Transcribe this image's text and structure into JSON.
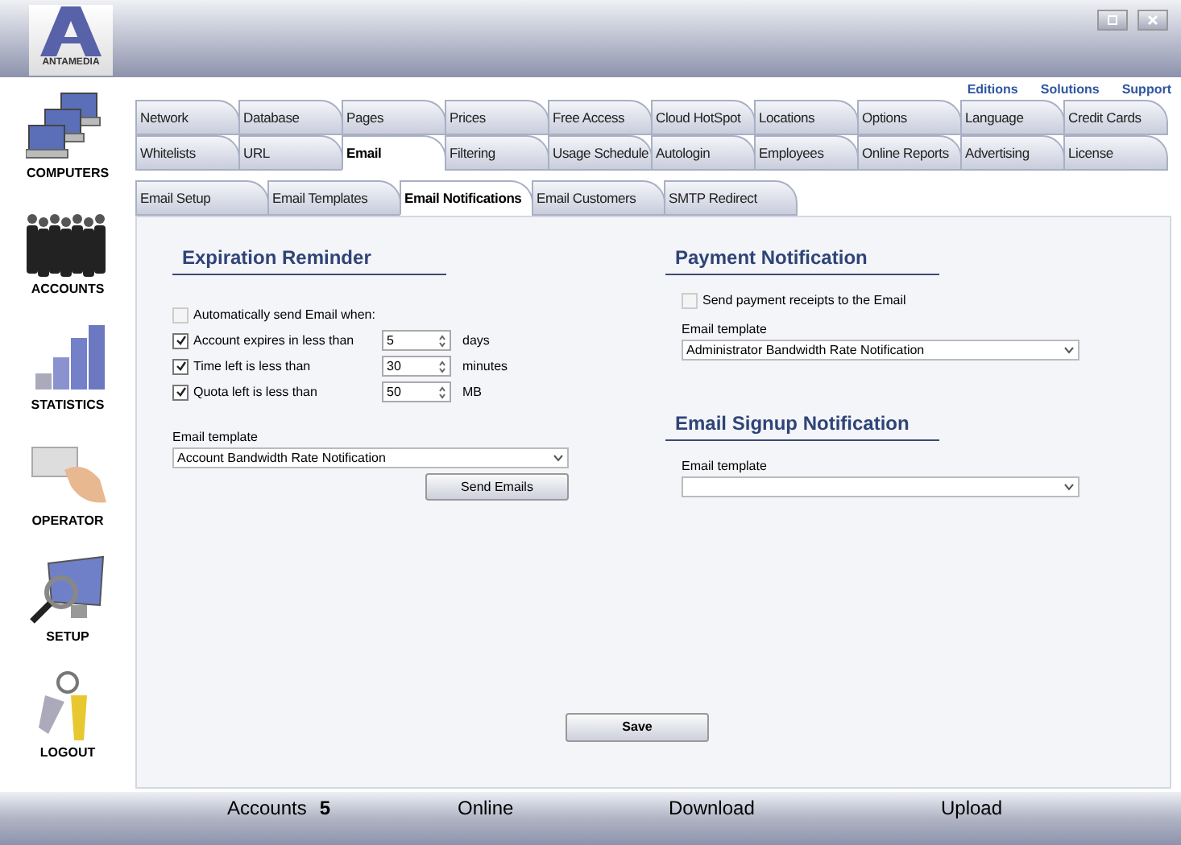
{
  "window": {
    "logo_text": "ANTAMEDIA",
    "buttons": [
      {
        "kind": "restore"
      },
      {
        "kind": "close"
      }
    ]
  },
  "top_links": [
    "Editions",
    "Solutions",
    "Support"
  ],
  "sidebar": {
    "items": [
      {
        "label": "COMPUTERS",
        "kind": "computers"
      },
      {
        "label": "ACCOUNTS",
        "kind": "accounts"
      },
      {
        "label": "STATISTICS",
        "kind": "statistics"
      },
      {
        "label": "OPERATOR",
        "kind": "operator"
      },
      {
        "label": "SETUP",
        "kind": "setup"
      },
      {
        "label": "LOGOUT",
        "kind": "logout"
      }
    ]
  },
  "tab_rows": [
    [
      {
        "label": "Network",
        "selected": false
      },
      {
        "label": "Database",
        "selected": false
      },
      {
        "label": "Pages",
        "selected": false
      },
      {
        "label": "Prices",
        "selected": false
      },
      {
        "label": "Free Access",
        "selected": false
      },
      {
        "label": "Cloud HotSpot",
        "selected": false
      },
      {
        "label": "Locations",
        "selected": false
      },
      {
        "label": "Options",
        "selected": false
      },
      {
        "label": "Language",
        "selected": false
      },
      {
        "label": "Credit Cards",
        "selected": false
      }
    ],
    [
      {
        "label": "Whitelists",
        "selected": false
      },
      {
        "label": "URL",
        "selected": false
      },
      {
        "label": "Email",
        "selected": true
      },
      {
        "label": "Filtering",
        "selected": false
      },
      {
        "label": "Usage Schedule",
        "selected": false
      },
      {
        "label": "Autologin",
        "selected": false
      },
      {
        "label": "Employees",
        "selected": false
      },
      {
        "label": "Online Reports",
        "selected": false
      },
      {
        "label": "Advertising",
        "selected": false
      },
      {
        "label": "License",
        "selected": false
      }
    ]
  ],
  "sub_tabs": [
    {
      "label": "Email Setup",
      "selected": false
    },
    {
      "label": "Email Templates",
      "selected": false
    },
    {
      "label": "Email Notifications",
      "selected": true
    },
    {
      "label": "Email Customers",
      "selected": false
    },
    {
      "label": "SMTP Redirect",
      "selected": false
    }
  ],
  "expiration_reminder": {
    "title": "Expiration Reminder",
    "auto_send": {
      "label": "Automatically send Email when:",
      "checked": false
    },
    "conditions": [
      {
        "label": "Account expires in less than",
        "checked": true,
        "value": "5",
        "unit": "days"
      },
      {
        "label": "Time left is less than",
        "checked": true,
        "value": "30",
        "unit": "minutes"
      },
      {
        "label": "Quota left is less than",
        "checked": true,
        "value": "50",
        "unit": "MB"
      }
    ],
    "template_label": "Email template",
    "template_value": "Account Bandwidth Rate Notification",
    "send_button": "Send Emails"
  },
  "payment_notification": {
    "title": "Payment Notification",
    "checkbox": {
      "label": "Send payment receipts to the Email",
      "checked": false
    },
    "template_label": "Email template",
    "template_value": "Administrator Bandwidth Rate Notification"
  },
  "signup_notification": {
    "title": "Email Signup Notification",
    "template_label": "Email template"
  },
  "save_button": "Save",
  "status_bar": [
    {
      "label": "Accounts",
      "value": "5"
    },
    {
      "label": "Online"
    },
    {
      "label": "Download"
    },
    {
      "label": "Upload"
    }
  ]
}
